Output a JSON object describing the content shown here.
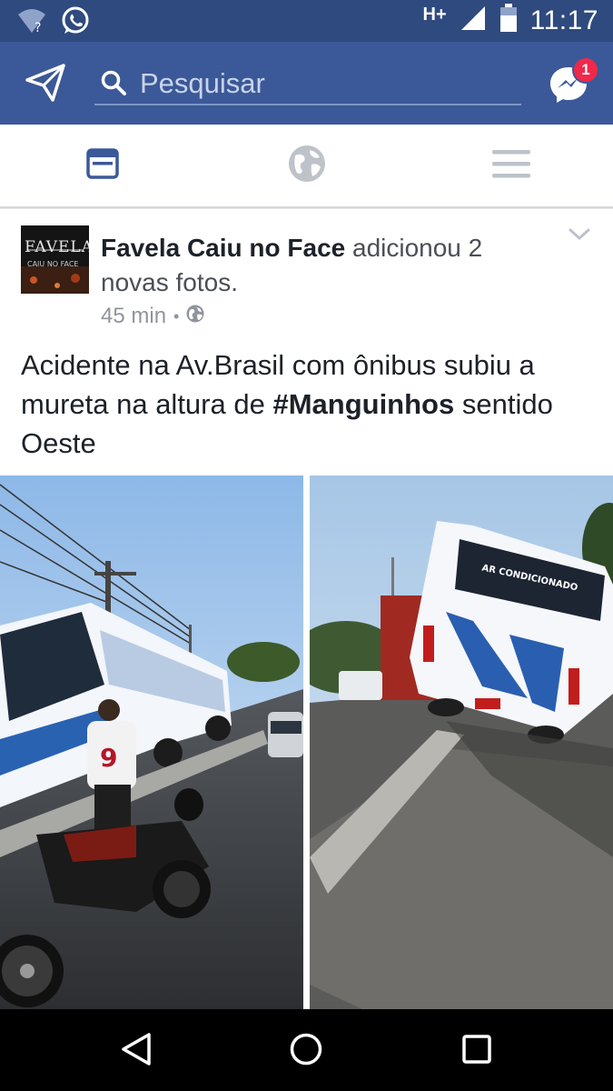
{
  "status_bar": {
    "network": "H+",
    "time": "11:17"
  },
  "header": {
    "search_placeholder": "Pesquisar",
    "messenger_badge": "1"
  },
  "tabs": [
    {
      "icon": "news-feed-icon",
      "active": true
    },
    {
      "icon": "globe-icon",
      "active": false
    },
    {
      "icon": "menu-icon",
      "active": false
    }
  ],
  "post": {
    "author": "Favela Caiu no Face",
    "action": "adicionou 2 novas fotos.",
    "time": "45 min",
    "separator": "•",
    "privacy_icon": "globe-icon",
    "avatar_text": "FAVELA",
    "avatar_subtext": "CAIU NO FACE",
    "text_before": "Acidente na Av.Brasil com ônibus subiu a mureta na altura de ",
    "hashtag": "#Manguinhos",
    "text_after": " sentido Oeste",
    "photos": [
      {
        "bus_rear_text": "AR CONDICIONADO"
      }
    ]
  },
  "colors": {
    "header": "#3b5998",
    "status_bar": "#2f4a7e",
    "active_tab": "#3b5998",
    "inactive_tab": "#bec2c9",
    "badge": "#f02849"
  }
}
